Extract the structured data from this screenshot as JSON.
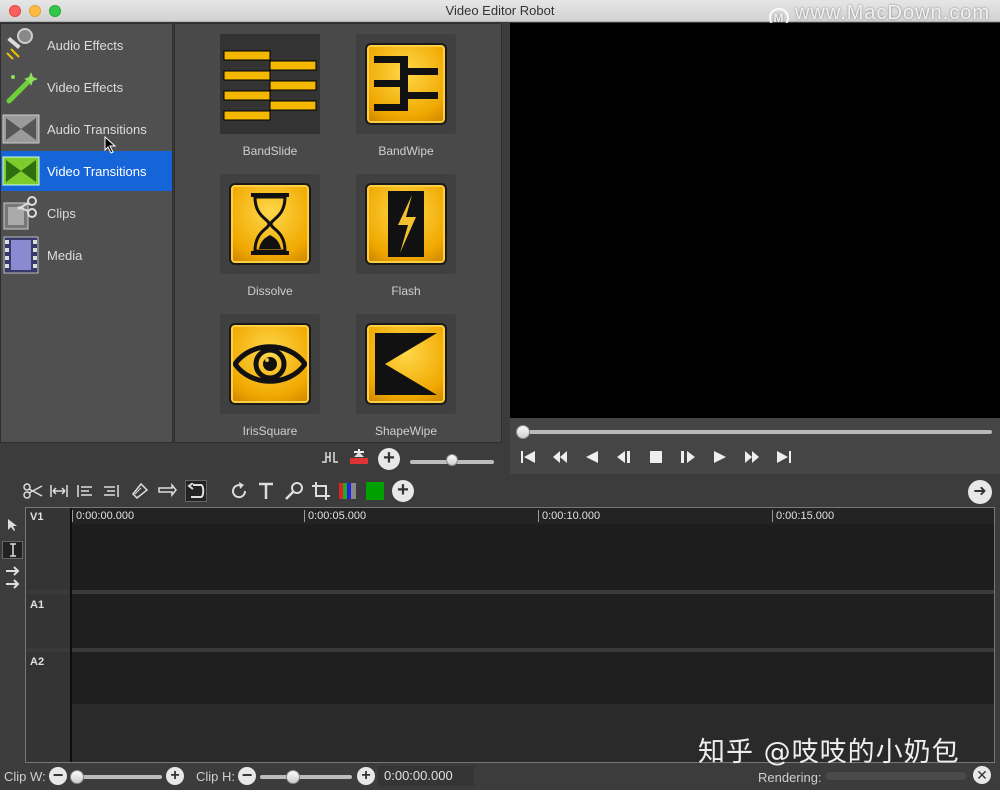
{
  "window": {
    "title": "Video Editor Robot"
  },
  "watermark_top": "www.MacDown.com",
  "watermark_bottom": "知乎 @吱吱的小奶包",
  "categories": [
    {
      "label": "Audio Effects",
      "icon": "audio-effects-icon",
      "selected": false
    },
    {
      "label": "Video Effects",
      "icon": "magic-wand-icon",
      "selected": false
    },
    {
      "label": "Audio Transitions",
      "icon": "audio-transition-icon",
      "selected": false
    },
    {
      "label": "Video Transitions",
      "icon": "video-transition-icon",
      "selected": true
    },
    {
      "label": "Clips",
      "icon": "film-scissors-icon",
      "selected": false
    },
    {
      "label": "Media",
      "icon": "film-strip-icon",
      "selected": false
    }
  ],
  "effects": [
    {
      "name": "BandSlide",
      "icon": "bandslide-icon"
    },
    {
      "name": "BandWipe",
      "icon": "bandwipe-icon"
    },
    {
      "name": "Dissolve",
      "icon": "hourglass-icon"
    },
    {
      "name": "Flash",
      "icon": "lightning-icon"
    },
    {
      "name": "IrisSquare",
      "icon": "eye-icon"
    },
    {
      "name": "ShapeWipe",
      "icon": "triangle-icon"
    }
  ],
  "timeline": {
    "tracks": [
      "V1",
      "A1",
      "A2"
    ],
    "ruler_ticks": [
      "0:00:00.000",
      "0:00:05.000",
      "0:00:10.000",
      "0:00:15.000"
    ]
  },
  "bottombar": {
    "clip_w_label": "Clip W:",
    "clip_h_label": "Clip H:",
    "time": "0:00:00.000",
    "rendering_label": "Rendering:"
  },
  "colors": {
    "selection": "#1565d8",
    "accent_gold": "#f0a800",
    "green_swatch": "#00a000"
  }
}
